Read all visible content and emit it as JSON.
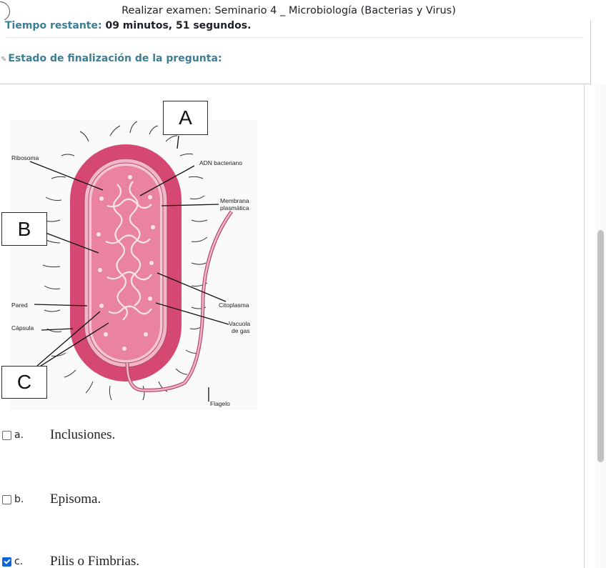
{
  "window": {
    "title": "Realizar examen: Seminario 4 _ Microbiología (Bacterias y Virus)"
  },
  "timer": {
    "label": "Tiempo restante:",
    "value": "09 minutos, 51 segundos."
  },
  "status": {
    "label": "Estado de finalización de la pregunta:"
  },
  "figure": {
    "boxes": {
      "a": "A",
      "b": "B",
      "c": "C"
    },
    "labels": {
      "ribosoma": "Ribosoma",
      "adn": "ADN bacteriano",
      "membrana_1": "Membrana",
      "membrana_2": "plasmática",
      "pared": "Pared",
      "capsula": "Cápsula",
      "citoplasma": "Citoplasma",
      "vacuola_1": "Vacuola",
      "vacuola_2": "de gas",
      "flagelo": "Flagelo"
    },
    "colors": {
      "capsule": "#d44872",
      "wall": "#f1b7c8",
      "cytoplasm": "#e9839f",
      "panel": "#fafafa"
    }
  },
  "options": [
    {
      "letter": "a.",
      "text": "Inclusiones.",
      "checked": false
    },
    {
      "letter": "b.",
      "text": "Episoma.",
      "checked": false
    },
    {
      "letter": "c.",
      "text": "Pilis o Fimbrias.",
      "checked": true
    }
  ],
  "colors": {
    "accent": "#3c7e95",
    "checkbox_checked": "#0b66d9"
  }
}
